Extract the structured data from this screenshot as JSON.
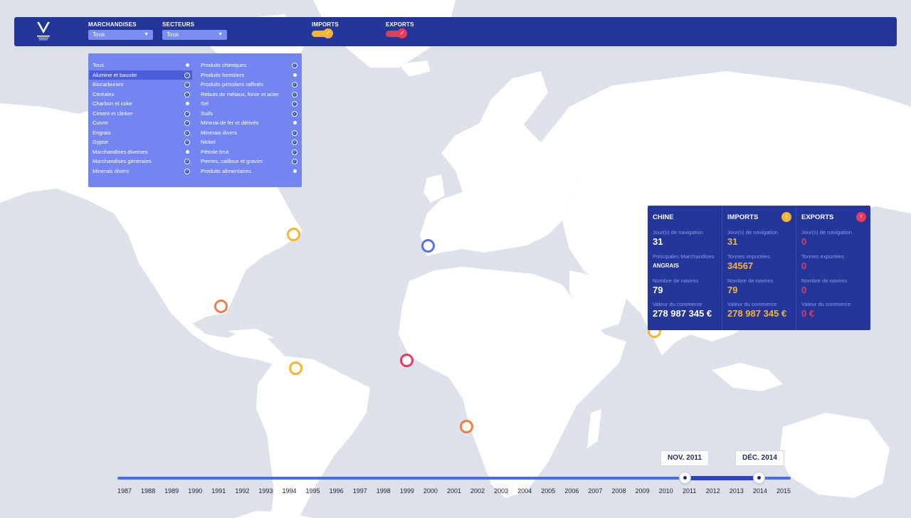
{
  "header": {
    "logo_icon": "port-logo-icon",
    "filters": [
      {
        "label": "MARCHANDISES",
        "value": "Tous"
      },
      {
        "label": "SECTEURS",
        "value": "Tous"
      }
    ],
    "toggles": [
      {
        "label": "IMPORTS",
        "state": true,
        "color": "#f4b534"
      },
      {
        "label": "EXPORTS",
        "state": true,
        "color": "#e8395f"
      }
    ]
  },
  "dropdown": {
    "col1": [
      {
        "label": "Tous",
        "checked": false,
        "selected": false
      },
      {
        "label": "Alumine et bauxite",
        "checked": true,
        "selected": true
      },
      {
        "label": "Biocarburant",
        "checked": true,
        "selected": false
      },
      {
        "label": "Céréales",
        "checked": true,
        "selected": false
      },
      {
        "label": "Charbon et coke",
        "checked": false,
        "selected": false
      },
      {
        "label": "Ciment et clinker",
        "checked": true,
        "selected": false
      },
      {
        "label": "Cuivre",
        "checked": true,
        "selected": false
      },
      {
        "label": "Engrais",
        "checked": true,
        "selected": false
      },
      {
        "label": "Gypse",
        "checked": true,
        "selected": false
      },
      {
        "label": "Marchandises diverses",
        "checked": false,
        "selected": false
      },
      {
        "label": "Marchandises générales",
        "checked": true,
        "selected": false
      },
      {
        "label": "Minerais divers",
        "checked": true,
        "selected": false
      }
    ],
    "col2": [
      {
        "label": "Produits chimiques",
        "checked": true
      },
      {
        "label": "Produits forestiers",
        "checked": false
      },
      {
        "label": "Produits pétroliers raffinés",
        "checked": true
      },
      {
        "label": "Rebuts de métaux, fonte et acier",
        "checked": true
      },
      {
        "label": "Sel",
        "checked": true
      },
      {
        "label": "Suifs",
        "checked": true
      },
      {
        "label": "Minerai de fer et dérivés",
        "checked": false
      },
      {
        "label": "Minerais divers",
        "checked": true
      },
      {
        "label": "Nickel",
        "checked": true
      },
      {
        "label": "Pétrole brut",
        "checked": true
      },
      {
        "label": "Pierres, cailloux et gravier",
        "checked": true
      },
      {
        "label": "Produits alimentaires",
        "checked": false
      }
    ]
  },
  "markers": [
    {
      "region": "Canada",
      "color": "#f4b534"
    },
    {
      "region": "Europe",
      "color": "#5a6fe0"
    },
    {
      "region": "Golfe du Mexique",
      "color": "#f07b4a"
    },
    {
      "region": "Guyane",
      "color": "#f4b534"
    },
    {
      "region": "Afrique de l'Ouest",
      "color": "#e8395f"
    },
    {
      "region": "Angola",
      "color": "#f07b4a"
    },
    {
      "region": "Inde",
      "color": "#f4b534"
    }
  ],
  "card": {
    "country": {
      "title": "CHINE",
      "nav_label": "Jour(s) de navigation",
      "nav_value": "31",
      "goods_label": "Principales Marchandises",
      "goods_value": "ANGRAIS",
      "ships_label": "Nombre de navires",
      "ships_value": "79",
      "trade_label": "Valeur du commerce",
      "trade_value": "278 987 345 €"
    },
    "imports": {
      "title": "IMPORTS",
      "icon": "import-icon",
      "nav_label": "Jour(s) de navigation",
      "nav_value": "31",
      "tonnes_label": "Tonnes importées",
      "tonnes_value": "34567",
      "ships_label": "Nombre de navires",
      "ships_value": "79",
      "trade_label": "Valeur du commerce",
      "trade_value": "278 987 345 €"
    },
    "exports": {
      "title": "EXPORTS",
      "icon": "export-icon",
      "nav_label": "Jour(s) de navigation",
      "nav_value": "0",
      "tonnes_label": "Tonnes exportées",
      "tonnes_value": "0",
      "ships_label": "Nombre de navires",
      "ships_value": "0",
      "trade_label": "Valeur du commerce",
      "trade_value": "0 €"
    }
  },
  "timeline": {
    "start_label": "NOV. 2011",
    "end_label": "DÉC. 2014",
    "years": [
      "1987",
      "1988",
      "1989",
      "1990",
      "1991",
      "1992",
      "1993",
      "1994",
      "1995",
      "1996",
      "1997",
      "1998",
      "1999",
      "2000",
      "2001",
      "2002",
      "2003",
      "2004",
      "2005",
      "2006",
      "2007",
      "2008",
      "2009",
      "2010",
      "2011",
      "2012",
      "2013",
      "2014",
      "2015"
    ]
  }
}
